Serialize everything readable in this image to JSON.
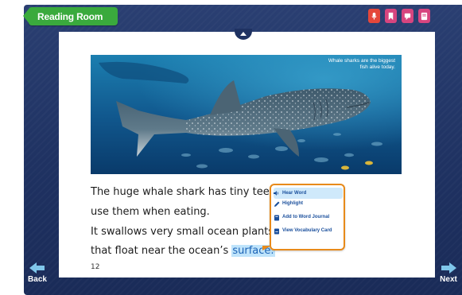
{
  "header": {
    "title": "Reading Room",
    "tools": [
      {
        "name": "record-icon",
        "color": "#e5473a"
      },
      {
        "name": "bookmark-icon",
        "color": "#d7457f"
      },
      {
        "name": "notes-icon",
        "color": "#d7457f"
      },
      {
        "name": "journal-icon",
        "color": "#d7457f"
      }
    ]
  },
  "photo": {
    "caption": "Whale sharks are the biggest fish alive today."
  },
  "story": {
    "line1": "The huge whale shark has tiny teeth",
    "line2": "use them when eating.",
    "line3": "It swallows very small ocean plants o",
    "line4_before": "that float near the ocean’s ",
    "line4_highlight": "surface.",
    "page_number": "12"
  },
  "popup": {
    "items": [
      {
        "label": "Hear Word",
        "icon": "speaker-icon"
      },
      {
        "label": "Highlight",
        "icon": "pencil-icon"
      },
      {
        "label": "Add to Word Journal",
        "icon": "journal-icon"
      },
      {
        "label": "View Vocabulary Card",
        "icon": "card-icon"
      }
    ]
  },
  "nav": {
    "back_label": "Back",
    "next_label": "Next"
  },
  "colors": {
    "frame": "#1f3262",
    "tab_green": "#3aaa3d",
    "popup_border": "#e88a1a",
    "highlight": "#bfe4fb",
    "arrow": "#7fc6ea"
  }
}
